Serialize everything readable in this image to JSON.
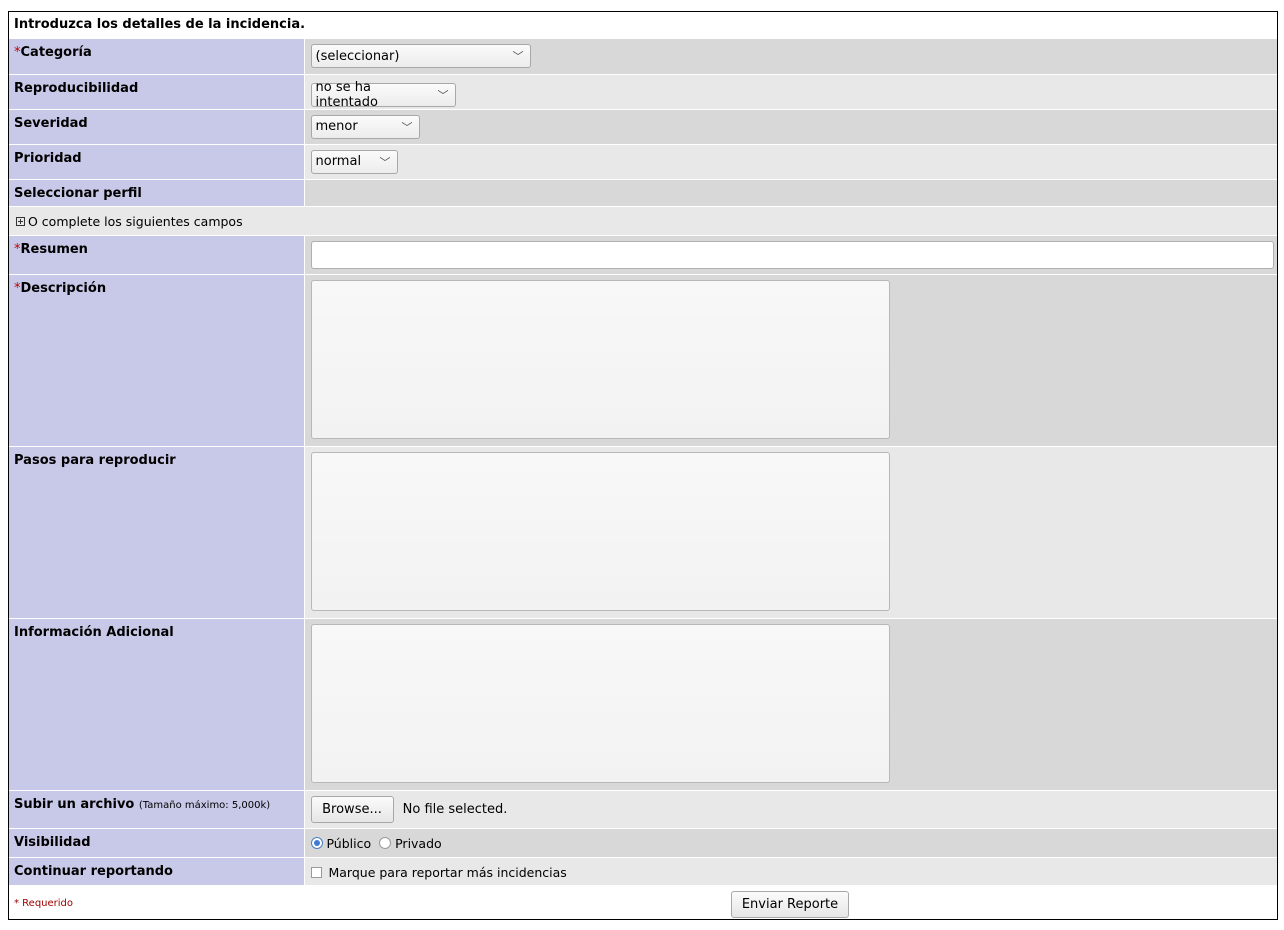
{
  "form": {
    "title": "Introduzca los detalles de la incidencia.",
    "required_mark": "*",
    "category": {
      "label": "Categoría",
      "value": "(seleccionar)"
    },
    "reproducibility": {
      "label": "Reproducibilidad",
      "value": "no se ha intentado"
    },
    "severity": {
      "label": "Severidad",
      "value": "menor"
    },
    "priority": {
      "label": "Prioridad",
      "value": "normal"
    },
    "profile": {
      "label": "Seleccionar perfil"
    },
    "optional_toggle": "O complete los siguientes campos",
    "summary": {
      "label": "Resumen",
      "value": ""
    },
    "description": {
      "label": "Descripción"
    },
    "steps": {
      "label": "Pasos para reproducir"
    },
    "additional": {
      "label": "Información Adicional"
    },
    "upload": {
      "label": "Subir un archivo",
      "max_size": "(Tamaño máximo: 5,000k)",
      "browse": "Browse...",
      "status": "No file selected."
    },
    "visibility": {
      "label": "Visibilidad",
      "public": "Público",
      "private": "Privado",
      "selected": "public"
    },
    "continue": {
      "label": "Continuar reportando",
      "checkbox": "Marque para reportar más incidencias",
      "checked": false
    },
    "required_note": "* Requerido",
    "submit": "Enviar Reporte"
  }
}
